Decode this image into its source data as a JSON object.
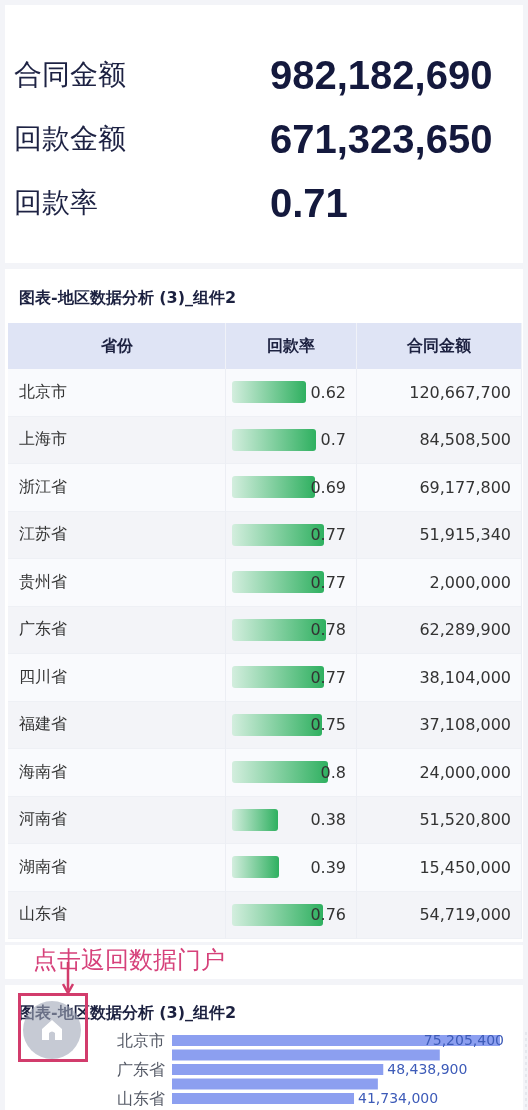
{
  "kpis": [
    {
      "label": "合同金额",
      "value": "982,182,690"
    },
    {
      "label": "回款金额",
      "value": "671,323,650"
    },
    {
      "label": "回款率",
      "value": "0.71"
    }
  ],
  "table_card": {
    "title": "图表-地区数据分析 (3)_组件2",
    "columns": [
      "省份",
      "回款率",
      "合同金额"
    ],
    "rows": [
      {
        "province": "北京市",
        "rate": "0.62",
        "level": 0.62,
        "amount": "120,667,700"
      },
      {
        "province": "上海市",
        "rate": "0.7",
        "level": 0.7,
        "amount": "84,508,500"
      },
      {
        "province": "浙江省",
        "rate": "0.69",
        "level": 0.69,
        "amount": "69,177,800"
      },
      {
        "province": "江苏省",
        "rate": "0.77",
        "level": 0.77,
        "amount": "51,915,340"
      },
      {
        "province": "贵州省",
        "rate": "0.77",
        "level": 0.77,
        "amount": "2,000,000"
      },
      {
        "province": "广东省",
        "rate": "0.78",
        "level": 0.78,
        "amount": "62,289,900"
      },
      {
        "province": "四川省",
        "rate": "0.77",
        "level": 0.77,
        "amount": "38,104,000"
      },
      {
        "province": "福建省",
        "rate": "0.75",
        "level": 0.75,
        "amount": "37,108,000"
      },
      {
        "province": "海南省",
        "rate": "0.8",
        "level": 0.8,
        "amount": "24,000,000"
      },
      {
        "province": "河南省",
        "rate": "0.38",
        "level": 0.38,
        "amount": "51,520,800"
      },
      {
        "province": "湖南省",
        "rate": "0.39",
        "level": 0.39,
        "amount": "15,450,000"
      },
      {
        "province": "山东省",
        "rate": "0.76",
        "level": 0.76,
        "amount": "54,719,000"
      }
    ]
  },
  "annotation": {
    "text": "点击返回数据门户"
  },
  "chart_card": {
    "title": "图表-地区数据分析 (3)_组件2",
    "chart_data": {
      "type": "bar",
      "orientation": "horizontal",
      "categories": [
        "北京市",
        null,
        "广东省",
        null,
        "山东省"
      ],
      "values": [
        75205400,
        61400000,
        48438900,
        47200000,
        41734000
      ],
      "value_labels": [
        "75,205,400",
        null,
        "48,438,900",
        null,
        "41,734,000"
      ],
      "color": "#8c9ff0"
    }
  }
}
